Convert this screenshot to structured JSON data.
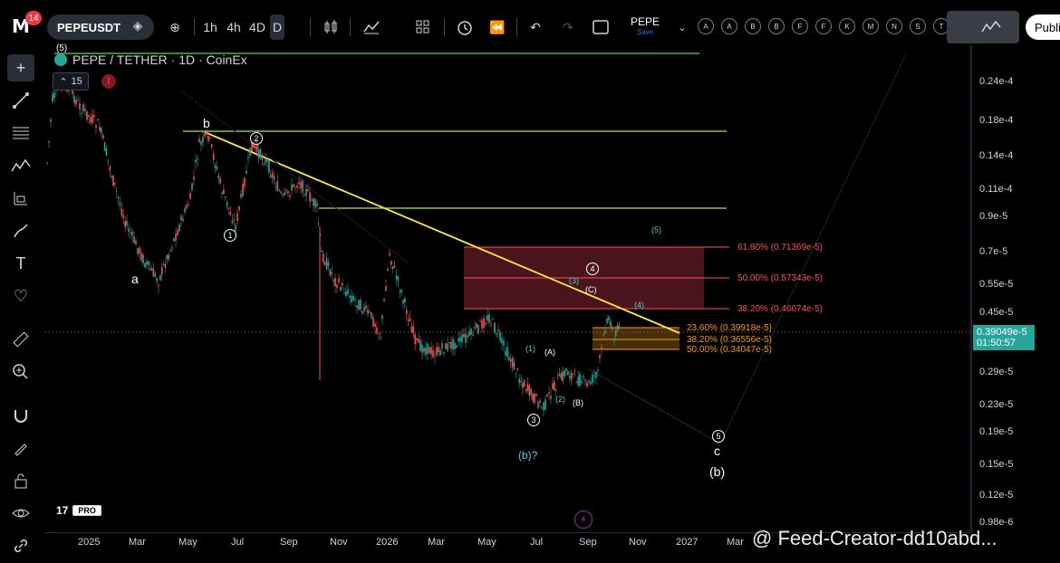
{
  "app": {
    "notifications": "14",
    "symbol": "PEPEUSDT",
    "timeframes": [
      "1h",
      "4h",
      "4D",
      "D"
    ],
    "active_timeframe": "D",
    "layout_name": "PEPE",
    "layout_save": "Save",
    "publish_label": "Publi",
    "drawing_buttons": [
      "A",
      "A",
      "B",
      "B",
      "F",
      "F",
      "K",
      "M",
      "N",
      "S",
      "T"
    ]
  },
  "chart": {
    "title": "PEPE / TETHER · 1D · CoinEx",
    "interval_badge": "15",
    "current_price": "0.39049e-5",
    "countdown": "01:50:57",
    "watermark": "@ Feed-Creator-dd10abd...",
    "tv_pro": "PRO",
    "tv_text": "17"
  },
  "chart_data": {
    "type": "line",
    "price_ticks": [
      "0.24e-4",
      "0.18e-4",
      "0.14e-4",
      "0.11e-4",
      "0.9e-5",
      "0.7e-5",
      "0.55e-5",
      "0.45e-5",
      "0.29e-5",
      "0.23e-5",
      "0.19e-5",
      "0.15e-5",
      "0.12e-5",
      "0.98e-6"
    ],
    "time_ticks": [
      "2025",
      "Mar",
      "May",
      "Jul",
      "Sep",
      "Nov",
      "2026",
      "Mar",
      "May",
      "Jul",
      "Sep",
      "Nov",
      "2027",
      "Mar"
    ],
    "fib_levels": [
      {
        "label": "61.80% (0.71369e-5)",
        "color": "red"
      },
      {
        "label": "50.00% (0.57343e-5)",
        "color": "red"
      },
      {
        "label": "38.20% (0.46074e-5)",
        "color": "red"
      },
      {
        "label": "23.60% (0.39918e-5)",
        "color": "orange"
      },
      {
        "label": "38.20% (0.36556e-5)",
        "color": "orange"
      },
      {
        "label": "50.00% (0.34047e-5)",
        "color": "orange"
      }
    ],
    "wave_labels": {
      "w5_top": "(5)",
      "a": "a",
      "b": "b",
      "c": "c",
      "b_paren": "(b)",
      "b_q": "(b)?",
      "A": "(A)",
      "B": "(B)",
      "C": "(C)",
      "w1": "(1)",
      "w2": "(2)",
      "w3": "(3)",
      "w4": "(4)",
      "w5": "(5)"
    },
    "circle_labels": [
      "1",
      "2",
      "3",
      "4",
      "5"
    ]
  }
}
